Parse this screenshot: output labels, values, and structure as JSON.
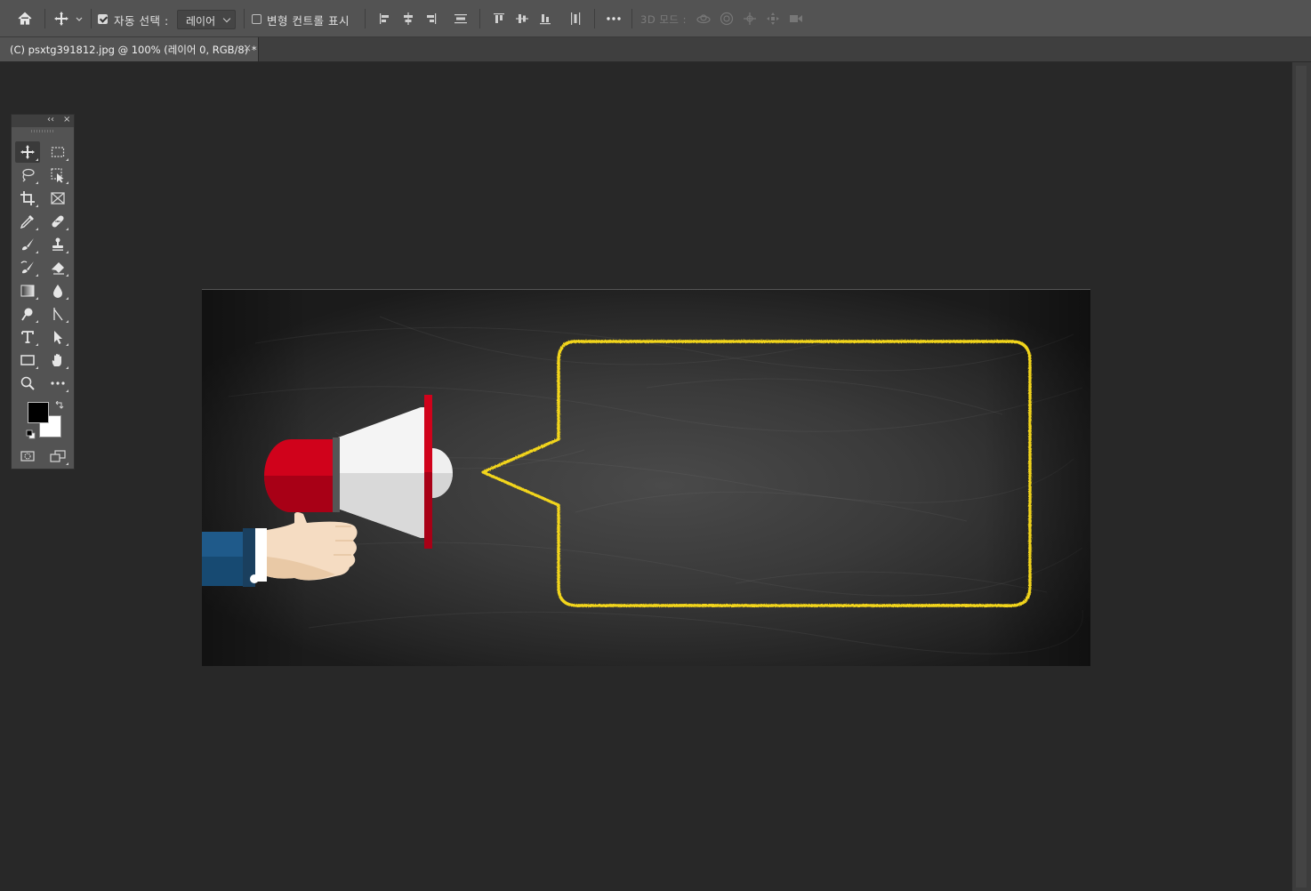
{
  "options_bar": {
    "home_icon": "home-icon",
    "move_tool_icon": "move-tool-icon",
    "auto_select_checked": true,
    "auto_select_label": "자동 선택 :",
    "auto_select_target": "레이어",
    "transform_controls_checked": false,
    "transform_controls_label": "변형 컨트롤 표시",
    "more_icon": "more-icon",
    "mode_3d_label": "3D 모드 :"
  },
  "document_tab": {
    "title": "(C) psxtg391812.jpg @ 100% (레이어 0, RGB/8) *",
    "close_glyph": "×"
  },
  "toolbox": {
    "collapse_glyph": "‹‹",
    "close_glyph": "×",
    "tools": [
      {
        "name": "move-tool",
        "icon": "move-icon",
        "selected": true
      },
      {
        "name": "rectangular-marquee-tool",
        "icon": "marquee-icon"
      },
      {
        "name": "lasso-tool",
        "icon": "lasso-icon"
      },
      {
        "name": "object-selection-tool",
        "icon": "object-select-icon"
      },
      {
        "name": "crop-tool",
        "icon": "crop-icon"
      },
      {
        "name": "frame-tool",
        "icon": "frame-icon"
      },
      {
        "name": "eyedropper-tool",
        "icon": "eyedropper-icon"
      },
      {
        "name": "healing-brush-tool",
        "icon": "bandage-icon"
      },
      {
        "name": "brush-tool",
        "icon": "brush-icon"
      },
      {
        "name": "clone-stamp-tool",
        "icon": "stamp-icon"
      },
      {
        "name": "history-brush-tool",
        "icon": "history-brush-icon"
      },
      {
        "name": "eraser-tool",
        "icon": "eraser-icon"
      },
      {
        "name": "gradient-tool",
        "icon": "gradient-icon"
      },
      {
        "name": "blur-tool",
        "icon": "drop-icon"
      },
      {
        "name": "dodge-tool",
        "icon": "dodge-icon"
      },
      {
        "name": "pen-tool",
        "icon": "pen-icon"
      },
      {
        "name": "type-tool",
        "icon": "type-icon"
      },
      {
        "name": "path-selection-tool",
        "icon": "arrow-icon"
      },
      {
        "name": "rectangle-tool",
        "icon": "rectangle-icon"
      },
      {
        "name": "hand-tool",
        "icon": "hand-icon"
      },
      {
        "name": "zoom-tool",
        "icon": "zoom-icon"
      },
      {
        "name": "edit-toolbar",
        "icon": "more-icon"
      }
    ],
    "foreground_color": "#000000",
    "background_color": "#ffffff"
  },
  "canvas": {
    "background": "chalkboard",
    "megaphone_colors": {
      "red": "#d0021b",
      "white": "#f2f2f2",
      "sleeve": "#1f5a8a",
      "skin": "#f5dcc2"
    },
    "bubble_stroke": "#f2d51b"
  }
}
